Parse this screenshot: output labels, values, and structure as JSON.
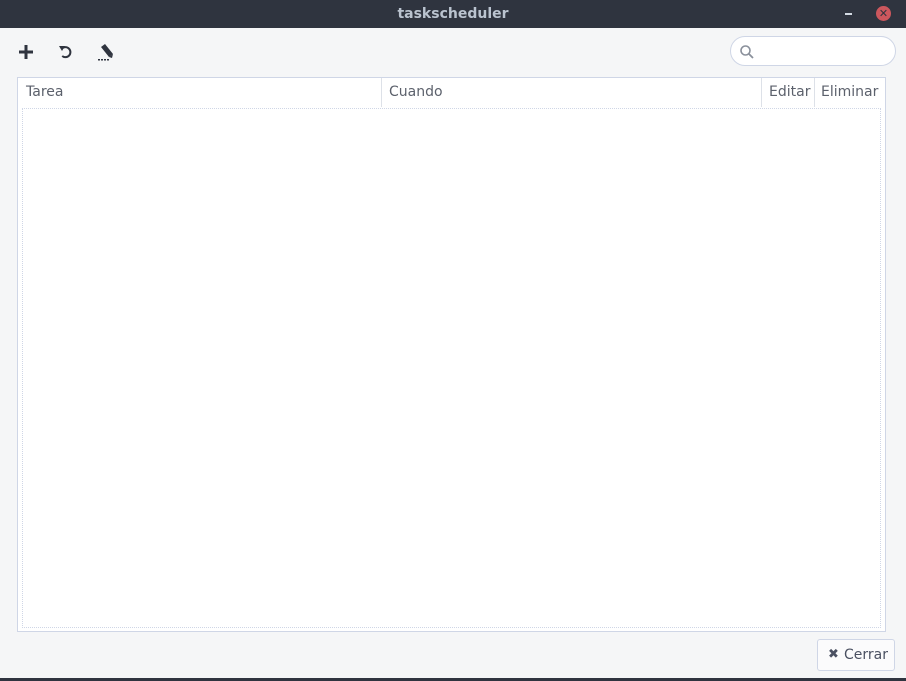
{
  "window": {
    "title": "taskscheduler",
    "minimize_icon": "minimize-icon",
    "close_icon": "close-icon",
    "close_color": "#cc575d"
  },
  "toolbar": {
    "add_icon": "plus-icon",
    "refresh_icon": "refresh-icon",
    "edit_icon": "edit-icon",
    "search_icon": "search-icon",
    "search_value": "",
    "search_placeholder": ""
  },
  "table": {
    "columns": [
      "Tarea",
      "Cuando",
      "Editar",
      "Eliminar"
    ],
    "rows": []
  },
  "footer": {
    "close_label": "Cerrar",
    "close_icon": "x-icon"
  }
}
